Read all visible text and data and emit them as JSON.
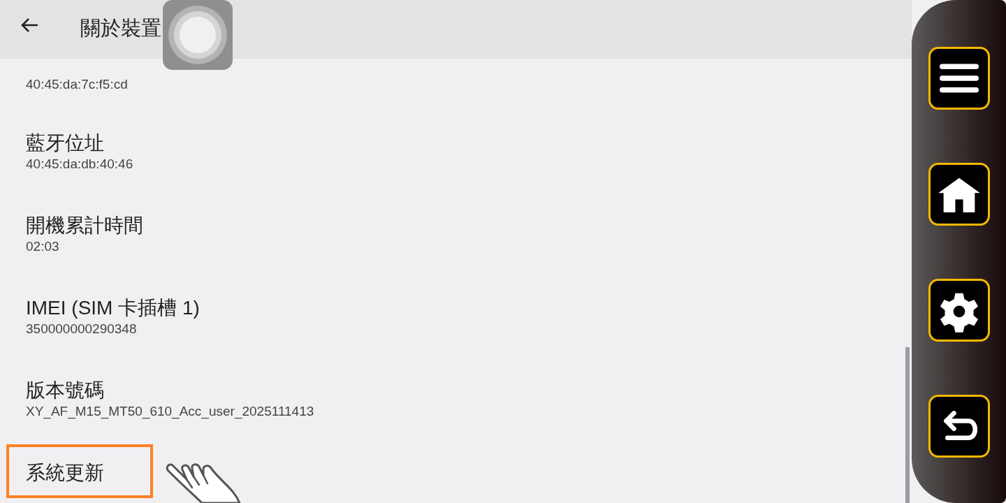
{
  "header": {
    "title": "關於裝置"
  },
  "items": [
    {
      "summary": "40:45:da:7c:f5:cd",
      "highlighted": false
    },
    {
      "title": "藍牙位址",
      "summary": "40:45:da:db:40:46",
      "highlighted": false
    },
    {
      "title": "開機累計時間",
      "summary": "02:03",
      "highlighted": false
    },
    {
      "title": "IMEI (SIM 卡插槽 1)",
      "summary": "350000000290348",
      "highlighted": false
    },
    {
      "title": "版本號碼",
      "summary": "XY_AF_M15_MT50_610_Acc_user_2025111413",
      "highlighted": false
    },
    {
      "title": "系統更新",
      "highlighted": true
    }
  ],
  "side_panel": {
    "buttons": [
      {
        "kind": "menu"
      },
      {
        "kind": "home"
      },
      {
        "kind": "settings"
      },
      {
        "kind": "back"
      }
    ]
  }
}
